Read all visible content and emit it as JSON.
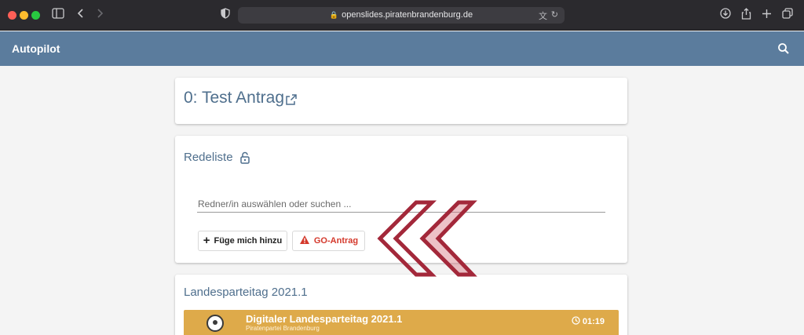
{
  "browser": {
    "url": "openslides.piratenbrandenburg.de"
  },
  "header": {
    "title": "Autopilot"
  },
  "motion": {
    "title": "0: Test Antrag"
  },
  "speakers": {
    "title": "Redeliste",
    "input_placeholder": "Redner/in auswählen oder suchen ...",
    "add_me_label": "Füge mich hinzu",
    "go_motion_label": "GO-Antrag"
  },
  "event": {
    "section_title": "Landesparteitag 2021.1",
    "name": "Digitaler Landesparteitag 2021.1",
    "organization": "Piratenpartei Brandenburg",
    "time": "01:19"
  },
  "colors": {
    "header": "#5b7c9d",
    "accent_text": "#4f6f8d",
    "warning": "#d4382b",
    "event_bar": "#deaa4a",
    "logo_stroke": "#a3283a"
  },
  "icons": {
    "lock": "lock-icon",
    "external": "open-external-icon",
    "search": "search-icon",
    "warning": "warning-triangle-icon",
    "clock": "clock-icon"
  }
}
